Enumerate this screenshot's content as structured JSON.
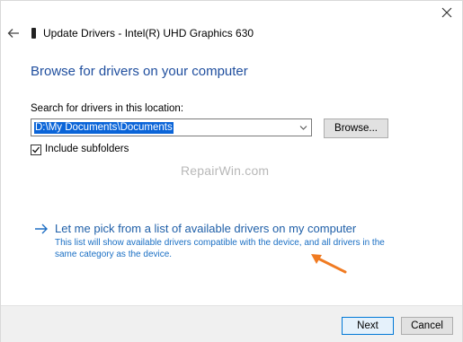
{
  "window": {
    "title": "Update Drivers - Intel(R) UHD Graphics 630",
    "close_icon": "close-icon",
    "back_icon": "back-arrow-icon",
    "device_icon": "device-icon"
  },
  "main": {
    "heading": "Browse for drivers on your computer",
    "search_label": "Search for drivers in this location:",
    "location_value": "D:\\My Documents\\Documents",
    "browse_label": "Browse...",
    "include_subfolders_label": "Include subfolders",
    "include_subfolders_checked": true,
    "watermark": "RepairWin.com",
    "pick_link": {
      "title": "Let me pick from a list of available drivers on my computer",
      "description": "This list will show available drivers compatible with the device, and all drivers in the same category as the device."
    }
  },
  "footer": {
    "next_label": "Next",
    "cancel_label": "Cancel"
  },
  "colors": {
    "heading": "#1f4e9e",
    "link": "#1f5fa8",
    "annotation": "#f07b22",
    "selection": "#0a64d8"
  }
}
